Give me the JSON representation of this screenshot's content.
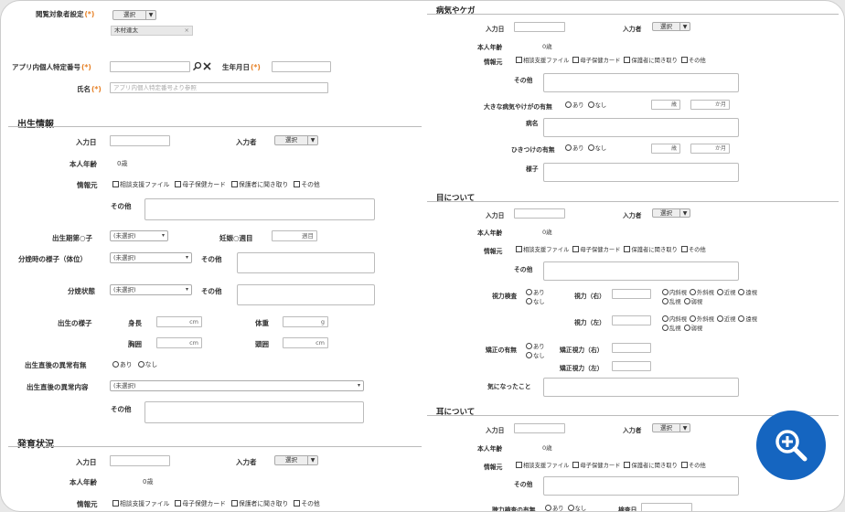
{
  "top": {
    "viewer_label": "閲覧対象者設定",
    "req": "(*)",
    "select_btn": "選択",
    "tag": "木村達太",
    "id_label": "アプリ内個人特定番号",
    "birth_label": "生年月日",
    "name_label": "氏名",
    "name_placeholder": "アプリ内個人特定番号より参照"
  },
  "birth": {
    "title": "出生情報",
    "input_date": "入力日",
    "inputter": "入力者",
    "select_btn": "選択",
    "age_label": "本人年齢",
    "age_value": "0歳",
    "info_label": "情報元",
    "checks": [
      "相談支援ファイル",
      "母子保健カード",
      "保護者に聞き取り",
      "その他"
    ],
    "other_label": "その他",
    "period_label": "出生期第○子",
    "period_select": "(未選択)",
    "preg_label": "妊娠○週目",
    "preg_unit": "週目",
    "delivery_label": "分娩時の様子（体位）",
    "delivery_select": "(未選択)",
    "delivery_other": "その他",
    "state_label": "分娩状態",
    "state_select": "(未選択)",
    "state_other": "その他",
    "appearance_label": "出生の様子",
    "height_label": "身長",
    "weight_label": "体重",
    "chest_label": "胸囲",
    "head_label": "頭囲",
    "cm": "cm",
    "g": "g",
    "abnormal_label": "出生直後の異常有無",
    "radio": [
      "あり",
      "なし"
    ],
    "abnormal_content_label": "出生直後の異常内容",
    "abnormal_select": "(未選択)",
    "abnormal_other": "その他"
  },
  "dev": {
    "title": "発育状況",
    "input_date": "入力日",
    "inputter": "入力者",
    "select_btn": "選択",
    "age_label": "本人年齢",
    "age_value": "0歳",
    "info_label": "情報元",
    "checks": [
      "相談支援ファイル",
      "母子保健カード",
      "保護者に聞き取り",
      "その他"
    ]
  },
  "ill": {
    "title": "病気やケガ",
    "input_date": "入力日",
    "inputter": "入力者",
    "select_btn": "選択",
    "age_label": "本人年齢",
    "age_value": "0歳",
    "info_label": "情報元",
    "checks": [
      "相談支援ファイル",
      "母子保健カード",
      "保護者に聞き取り",
      "その他"
    ],
    "other_label": "その他",
    "major_label": "大きな病気やけがの有無",
    "radio": [
      "あり",
      "なし"
    ],
    "age_unit": "歳",
    "month_unit": "か月",
    "disease_label": "病名",
    "seizure_label": "ひきつけの有無",
    "condition_label": "様子"
  },
  "eye": {
    "title": "目について",
    "input_date": "入力日",
    "inputter": "入力者",
    "select_btn": "選択",
    "age_label": "本人年齢",
    "age_value": "0歳",
    "info_label": "情報元",
    "checks": [
      "相談支援ファイル",
      "母子保健カード",
      "保護者に聞き取り",
      "その他"
    ],
    "other_label": "その他",
    "test_label": "視力検査",
    "radio": [
      "あり",
      "なし"
    ],
    "right_label": "視力（右）",
    "left_label": "視力（左）",
    "vision_opts": [
      "内斜視",
      "外斜視",
      "近視",
      "遠視",
      "乱視",
      "弱視"
    ],
    "correct_label": "矯正の有無",
    "correct_right": "矯正視力（右）",
    "correct_left": "矯正視力（左）",
    "concern_label": "気になったこと"
  },
  "ear": {
    "title": "耳について",
    "input_date": "入力日",
    "inputter": "入力者",
    "select_btn": "選択",
    "age_label": "本人年齢",
    "age_value": "0歳",
    "info_label": "情報元",
    "checks": [
      "相談支援ファイル",
      "母子保健カード",
      "保護者に聞き取り",
      "その他"
    ],
    "other_label": "その他",
    "hearing_label": "聴力検査の有無",
    "radio": [
      "あり",
      "なし"
    ],
    "test_date": "検査日"
  }
}
